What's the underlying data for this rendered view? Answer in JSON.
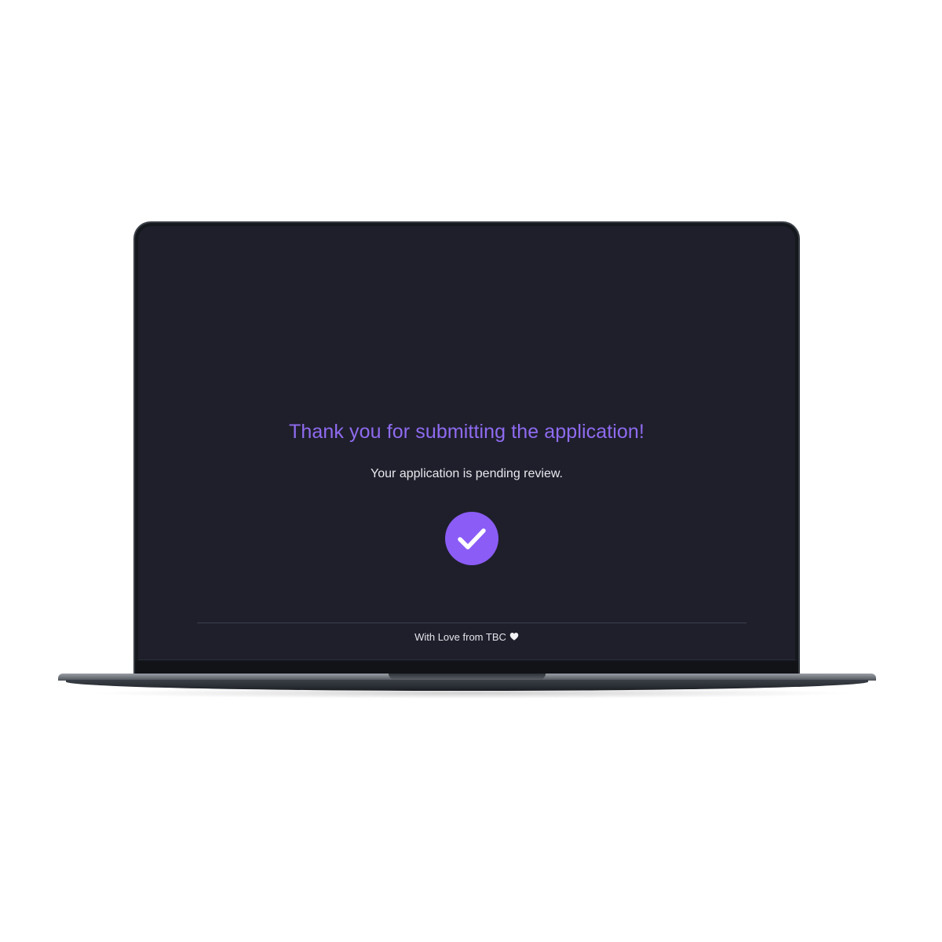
{
  "confirmation": {
    "title": "Thank you for submitting the application!",
    "subtitle": "Your application is pending review.",
    "status_icon": "checkmark-circle-icon"
  },
  "footer": {
    "text": "With Love from TBC",
    "icon": "heart-icon"
  },
  "colors": {
    "accent": "#8b5cf6",
    "title": "#8f6bf0",
    "screen_background": "#1e1f2b",
    "text": "#e8e8ee"
  }
}
